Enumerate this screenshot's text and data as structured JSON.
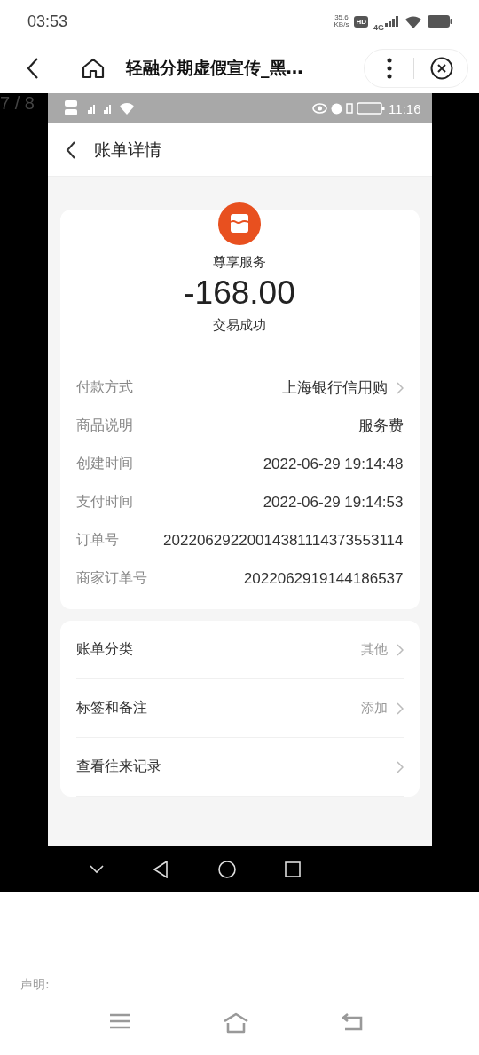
{
  "status_bar": {
    "time": "03:53",
    "net_speed": "35.6",
    "net_unit": "KB/s",
    "hd": "HD",
    "network": "4G"
  },
  "browser": {
    "title": "轻融分期虚假宣传_黑…"
  },
  "viewer": {
    "counter": "7 / 8"
  },
  "screenshot": {
    "status_bar": {
      "time": "11:16"
    },
    "header": {
      "title": "账单详情"
    },
    "summary": {
      "merchant": "尊享服务",
      "amount": "-168.00",
      "status": "交易成功"
    },
    "details": [
      {
        "label": "付款方式",
        "value": "上海银行信用购",
        "link": true
      },
      {
        "label": "商品说明",
        "value": "服务费",
        "link": false
      },
      {
        "label": "创建时间",
        "value": "2022-06-29 19:14:48",
        "link": false
      },
      {
        "label": "支付时间",
        "value": "2022-06-29 19:14:53",
        "link": false
      },
      {
        "label": "订单号",
        "value": "20220629220014381114373553114",
        "link": false
      },
      {
        "label": "商家订单号",
        "value": "2022062919144186537",
        "link": false
      }
    ],
    "actions": [
      {
        "label": "账单分类",
        "value": "其他"
      },
      {
        "label": "标签和备注",
        "value": "添加"
      },
      {
        "label": "查看往来记录"
      }
    ]
  },
  "footer": {
    "statement": "声明:"
  }
}
